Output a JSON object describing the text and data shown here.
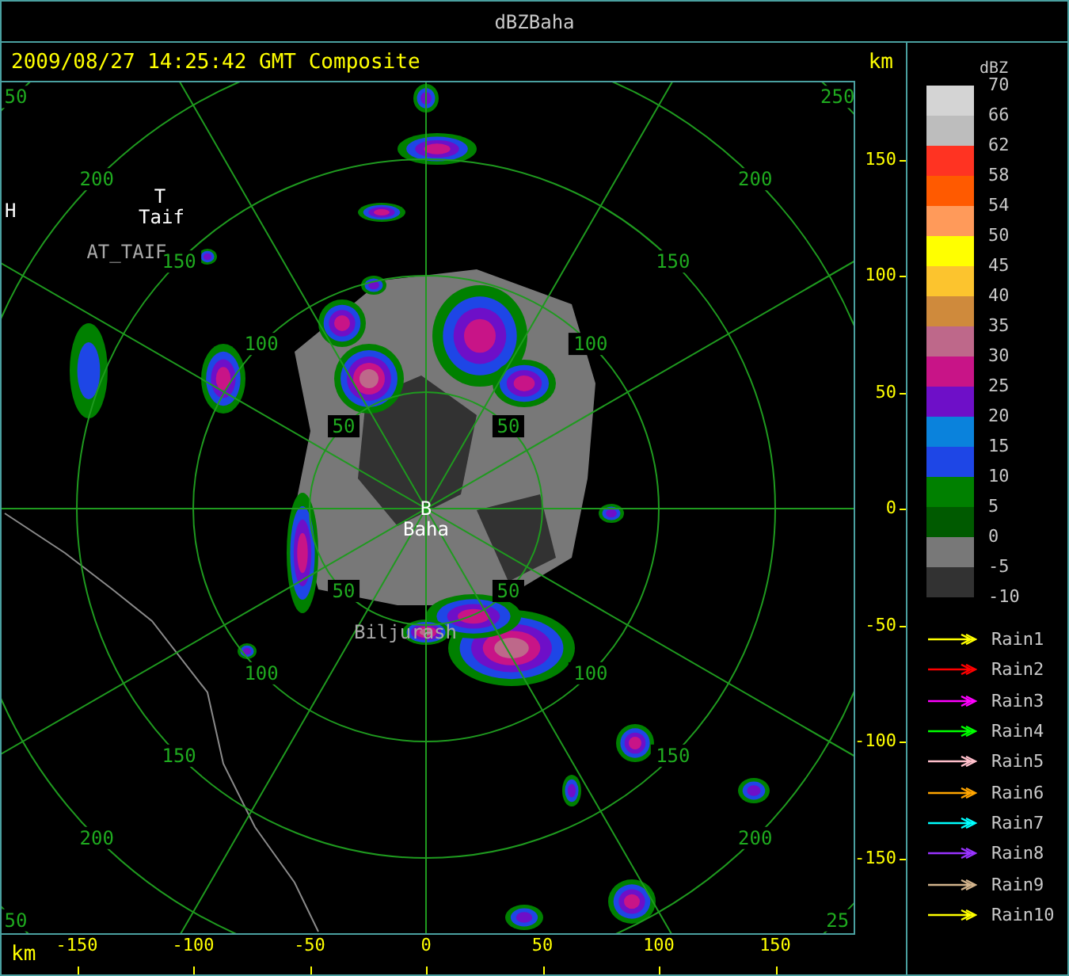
{
  "window": {
    "title": "dBZBaha"
  },
  "header": {
    "timestamp": "2009/08/27 14:25:42 GMT Composite"
  },
  "map": {
    "range_rings": [
      {
        "labels": [
          "50",
          "50",
          "50",
          "50"
        ]
      },
      {
        "labels": [
          "100",
          "100",
          "100",
          "100"
        ]
      },
      {
        "labels": [
          "150",
          "150",
          "150",
          "150"
        ]
      },
      {
        "labels": [
          "200",
          "200",
          "200",
          "200"
        ]
      },
      {
        "labels": [
          "50",
          "250",
          "50",
          "25"
        ]
      }
    ],
    "places": [
      {
        "text": "T",
        "kind": "station"
      },
      {
        "text": "Taif",
        "kind": "station"
      },
      {
        "text": "AT_TAIF",
        "kind": "site"
      },
      {
        "text": "H",
        "kind": "station"
      },
      {
        "text": "B",
        "kind": "station"
      },
      {
        "text": "Baha",
        "kind": "station"
      },
      {
        "text": "Biljurash",
        "kind": "site"
      }
    ]
  },
  "y_axis": {
    "unit": "km",
    "ticks": [
      "150",
      "100",
      "50",
      "0",
      "-50",
      "-100",
      "-150"
    ]
  },
  "x_axis": {
    "unit": "km",
    "ticks": [
      "-150",
      "-100",
      "-50",
      "0",
      "50",
      "100",
      "150"
    ]
  },
  "legend": {
    "title": "dBZ",
    "bins": [
      {
        "label": "70",
        "color": "#d4d4d4"
      },
      {
        "label": "66",
        "color": "#bdbdbd"
      },
      {
        "label": "62",
        "color": "#ff3322"
      },
      {
        "label": "58",
        "color": "#ff5a00"
      },
      {
        "label": "54",
        "color": "#ff9a5a"
      },
      {
        "label": "50",
        "color": "#ffff00"
      },
      {
        "label": "45",
        "color": "#fcc42e"
      },
      {
        "label": "40",
        "color": "#cf8a3c"
      },
      {
        "label": "35",
        "color": "#be688a"
      },
      {
        "label": "30",
        "color": "#c81487"
      },
      {
        "label": "25",
        "color": "#6e0fc8"
      },
      {
        "label": "20",
        "color": "#0a82dc"
      },
      {
        "label": "15",
        "color": "#1e46e6"
      },
      {
        "label": "10",
        "color": "#008000"
      },
      {
        "label": "5",
        "color": "#005a00"
      },
      {
        "label": "0",
        "color": "#787878"
      },
      {
        "label": "-5",
        "color": "#323232"
      }
    ],
    "last_label": "-10",
    "tracks": [
      {
        "label": "Rain1",
        "color": "#ffff00"
      },
      {
        "label": "Rain2",
        "color": "#ff0000"
      },
      {
        "label": "Rain3",
        "color": "#ff00ff"
      },
      {
        "label": "Rain4",
        "color": "#00ff00"
      },
      {
        "label": "Rain5",
        "color": "#ffc0cb"
      },
      {
        "label": "Rain6",
        "color": "#ffa500"
      },
      {
        "label": "Rain7",
        "color": "#00ffff"
      },
      {
        "label": "Rain8",
        "color": "#9933ff"
      },
      {
        "label": "Rain9",
        "color": "#d2b48c"
      },
      {
        "label": "Rain10",
        "color": "#ffff00"
      }
    ]
  }
}
